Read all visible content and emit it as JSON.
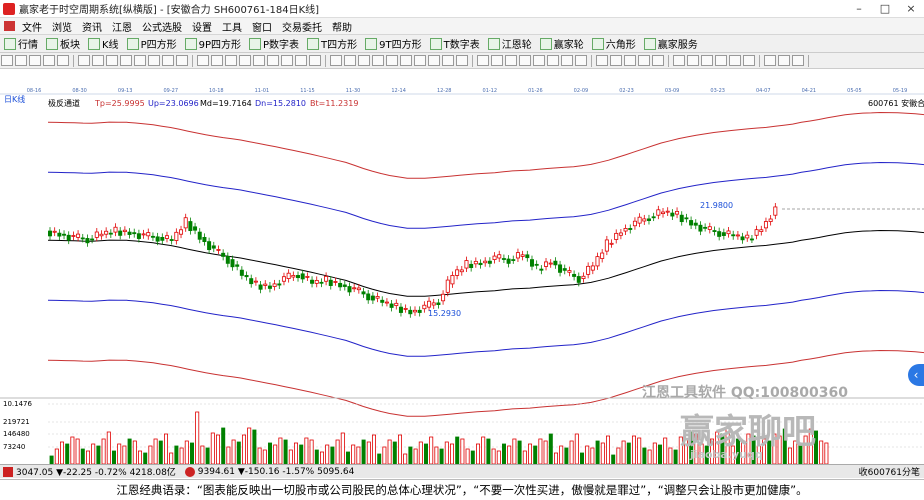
{
  "window": {
    "title": "赢家老于时空周期系统[纵横版] - [安徽合力  SH600761-184日K线]",
    "controls": [
      "–",
      "□",
      "×"
    ]
  },
  "menu": [
    "文件",
    "浏览",
    "资讯",
    "江恩",
    "公式选股",
    "设置",
    "工具",
    "窗口",
    "交易委托",
    "帮助"
  ],
  "toolbar1": [
    "行情",
    "板块",
    "K线",
    "P四方形",
    "9P四方形",
    "P数字表",
    "T四方形",
    "9T四方形",
    "T数字表",
    "江恩轮",
    "赢家轮",
    "六角形",
    "赢家服务"
  ],
  "chart": {
    "period_label": "日K线",
    "indicator_name": "极反通道",
    "tp": "Tp=25.9995",
    "up": "Up=23.0696",
    "md": "Md=19.7164",
    "dn": "Dn=15.2810",
    "bt": "Bt=11.2319",
    "stock": "600761  安徽合力",
    "high_label": "21.9800",
    "low_label": "15.2930",
    "volume_ticks": [
      "10.1476",
      "219721",
      "146480",
      "73240"
    ],
    "watermark1": "江恩工具软件  QQ:100800360",
    "watermark2": "赢家聊吧",
    "watermark3": "jiaoba.yuqq"
  },
  "chart_data": {
    "type": "candlestick",
    "x_ticks": [
      "08-16",
      "08-30",
      "09-13",
      "09-27",
      "10-18",
      "11-01",
      "11-15",
      "11-30",
      "12-14",
      "12-28",
      "01-12",
      "01-26",
      "02-09",
      "02-23",
      "03-09",
      "03-23",
      "04-07",
      "04-21",
      "05-05",
      "05-19"
    ],
    "price_labels": {
      "high": 21.98,
      "low": 15.293
    },
    "indicator_values": {
      "Tp": 25.9995,
      "Up": 23.0696,
      "Md": 19.7164,
      "Dn": 15.281,
      "Bt": 11.2319
    },
    "close_path": [
      20.4,
      20.2,
      20.0,
      19.9,
      20.2,
      20.4,
      20.3,
      20.1,
      20.0,
      19.8,
      21.0,
      20.0,
      19.2,
      18.6,
      17.6,
      17.0,
      16.9,
      17.4,
      17.7,
      17.1,
      17.3,
      17.0,
      16.7,
      16.3,
      15.9,
      15.6,
      15.3,
      15.6,
      16.0,
      17.6,
      18.3,
      18.4,
      18.7,
      18.6,
      18.9,
      18.0,
      18.5,
      17.8,
      17.4,
      18.2,
      19.6,
      20.4,
      20.9,
      21.3,
      21.6,
      21.4,
      20.9,
      20.5,
      20.3,
      20.1,
      19.9,
      20.6,
      21.8
    ],
    "volume_ticks": [
      10.1476,
      219721,
      146480,
      73240
    ]
  },
  "statusbar": {
    "sh": "3047.05 ▼-22.25 -0.72% 4218.08亿",
    "sz": "9394.61 ▼-150.16 -1.57% 5095.64",
    "right": "收600761分笔"
  },
  "footer": {
    "quote": "江恩经典语录：“图表能反映出一切股市或公司股民的总体心理状况”，“不要一次性买进，傲慢就是罪过”，“调整只会让股市更加健康”。"
  },
  "colors": {
    "up": "#e00000",
    "down": "#008000",
    "outer": "#c83232",
    "inner": "#2323c8",
    "mid": "#000000"
  }
}
